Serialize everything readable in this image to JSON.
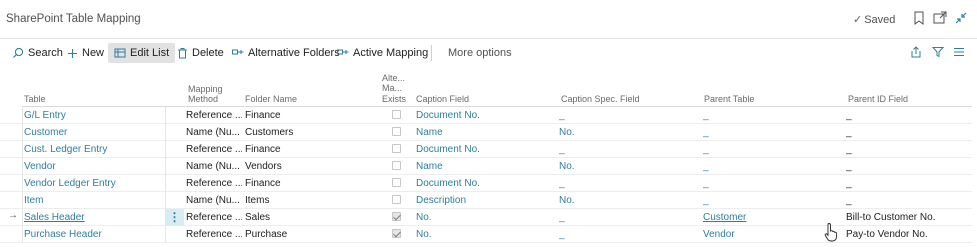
{
  "page": {
    "title": "SharePoint Table Mapping",
    "saved_label": "Saved"
  },
  "icons": {
    "bookmark": "bookmark-icon",
    "open_new": "open-in-new-window-icon",
    "collapse": "collapse-icon",
    "share": "share-icon",
    "filter": "filter-icon",
    "list": "list-view-icon"
  },
  "actions": {
    "search": "Search",
    "new": "New",
    "edit_list": "Edit List",
    "delete": "Delete",
    "alternative_folders": "Alternative Folders",
    "active_mapping": "Active Mapping",
    "more_options": "More options"
  },
  "columns": {
    "table": "Table",
    "mapping_method_1": "Mapping",
    "mapping_method_2": "Method",
    "folder_name": "Folder Name",
    "alt_1": "Alte...",
    "alt_2": "Ma...",
    "alt_3": "Exists",
    "caption_field": "Caption Field",
    "caption_spec_field": "Caption Spec. Field",
    "parent_table": "Parent Table",
    "parent_id_field": "Parent ID Field"
  },
  "rows": [
    {
      "table": "G/L Entry",
      "method": "Reference ...",
      "folder": "Finance",
      "alt": false,
      "caption": "Document No.",
      "spec": "_",
      "parent": "_",
      "parent_id": "_"
    },
    {
      "table": "Customer",
      "method": "Name (Nu...",
      "folder": "Customers",
      "alt": false,
      "caption": "Name",
      "spec": "No.",
      "parent": "_",
      "parent_id": "_"
    },
    {
      "table": "Cust. Ledger Entry",
      "method": "Reference ...",
      "folder": "Finance",
      "alt": false,
      "caption": "Document No.",
      "spec": "_",
      "parent": "_",
      "parent_id": "_"
    },
    {
      "table": "Vendor",
      "method": "Name (Nu...",
      "folder": "Vendors",
      "alt": false,
      "caption": "Name",
      "spec": "No.",
      "parent": "_",
      "parent_id": "_"
    },
    {
      "table": "Vendor Ledger Entry",
      "method": "Reference ...",
      "folder": "Finance",
      "alt": false,
      "caption": "Document No.",
      "spec": "_",
      "parent": "_",
      "parent_id": "_"
    },
    {
      "table": "Item",
      "method": "Name (Nu...",
      "folder": "Items",
      "alt": false,
      "caption": "Description",
      "spec": "No.",
      "parent": "_",
      "parent_id": "_"
    },
    {
      "table": "Sales Header",
      "method": "Reference ...",
      "folder": "Sales",
      "alt": true,
      "caption": "No.",
      "spec": "_",
      "parent": "Customer",
      "parent_id": "Bill-to Customer No."
    },
    {
      "table": "Purchase Header",
      "method": "Reference ...",
      "folder": "Purchase",
      "alt": true,
      "caption": "No.",
      "spec": "_",
      "parent": "Vendor",
      "parent_id": "Pay-to Vendor No."
    }
  ],
  "colors": {
    "link": "#2d7f9f",
    "selected_handle": "#d8edf3",
    "active_button": "#e2e2e2"
  }
}
